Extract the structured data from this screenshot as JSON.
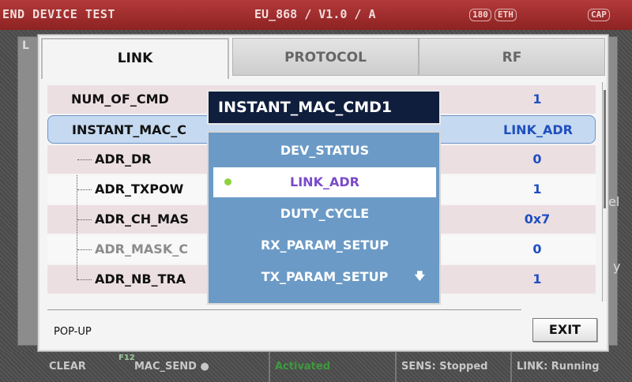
{
  "topbar": {
    "title": "END DEVICE TEST",
    "version": "EU_868 / V1.0 / A",
    "badge_1": "180",
    "badge_2": "ETH",
    "badge_3": "CAP"
  },
  "tabs": [
    {
      "label": "LINK"
    },
    {
      "label": "PROTOCOL"
    },
    {
      "label": "RF"
    }
  ],
  "list": {
    "rows": [
      {
        "label": "NUM_OF_CMD",
        "value": "1"
      },
      {
        "label": "INSTANT_MAC_C",
        "value": "LINK_ADR"
      },
      {
        "label": "ADR_DR",
        "value": "0"
      },
      {
        "label": "ADR_TXPOW",
        "value": "1"
      },
      {
        "label": "ADR_CH_MAS",
        "value": "0x7"
      },
      {
        "label": "ADR_MASK_C",
        "value": "0"
      },
      {
        "label": "ADR_NB_TRA",
        "value": "1"
      }
    ]
  },
  "popup": {
    "title": "INSTANT_MAC_CMD1",
    "options": [
      {
        "label": "DEV_STATUS"
      },
      {
        "label": "LINK_ADR"
      },
      {
        "label": "DUTY_CYCLE"
      },
      {
        "label": "RX_PARAM_SETUP"
      },
      {
        "label": "TX_PARAM_SETUP"
      }
    ],
    "more_arrow": "🡇"
  },
  "footer": {
    "popup_label": "POP-UP",
    "exit_label": "EXIT"
  },
  "background": {
    "left_letter": "L",
    "right_fragment_1": "el",
    "right_fragment_2": "y"
  },
  "bottombar": {
    "clear": "CLEAR",
    "fkey": "F12",
    "mac_send": "MAC_SEND ●",
    "activated": "Activated",
    "sens": "SENS: Stopped",
    "link": "LINK: Running"
  },
  "colors": {
    "accent_red": "#a32f2f",
    "selected_row": "#c5d9f0",
    "popup_body": "#6b9ac6",
    "value_blue": "#1f4fbf",
    "selected_option_text": "#7a4bc9"
  }
}
